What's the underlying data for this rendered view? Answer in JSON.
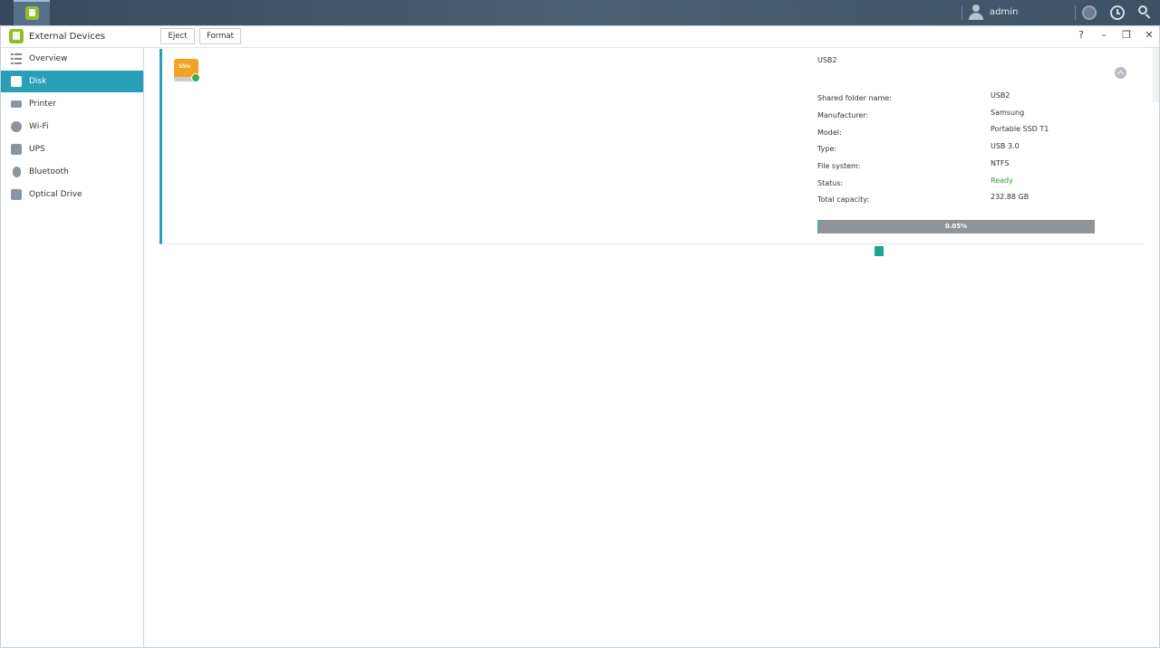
{
  "taskbar": {
    "username": "admin"
  },
  "window": {
    "title": "External Devices",
    "controls": {
      "help": "?",
      "minimize": "–",
      "restore": "❐",
      "close": "✕"
    }
  },
  "sidebar": {
    "items": [
      {
        "label": "Overview",
        "icon": "list-icon",
        "active": false
      },
      {
        "label": "Disk",
        "icon": "disk-icon",
        "active": true
      },
      {
        "label": "Printer",
        "icon": "printer-icon",
        "active": false
      },
      {
        "label": "Wi-Fi",
        "icon": "wifi-icon",
        "active": false
      },
      {
        "label": "UPS",
        "icon": "ups-icon",
        "active": false
      },
      {
        "label": "Bluetooth",
        "icon": "bluetooth-icon",
        "active": false
      },
      {
        "label": "Optical Drive",
        "icon": "optical-drive-icon",
        "active": false
      }
    ]
  },
  "toolbar": {
    "eject_label": "Eject",
    "format_label": "Format"
  },
  "device": {
    "name": "USB2",
    "fields": [
      {
        "label": "Shared folder name:",
        "value": "USB2"
      },
      {
        "label": "Manufacturer:",
        "value": "Samsung"
      },
      {
        "label": "Model:",
        "value": "Portable SSD T1"
      },
      {
        "label": "Type:",
        "value": "USB 3.0"
      },
      {
        "label": "File system:",
        "value": "NTFS"
      },
      {
        "label": "Status:",
        "value": "Ready"
      },
      {
        "label": "Total capacity:",
        "value": "232.88 GB"
      }
    ],
    "usage_text": "0.05%",
    "usage_percent": 0.05
  },
  "colors": {
    "accent": "#2a9fb8",
    "used": "#2ab29a",
    "status_ok": "#3a9a3a"
  }
}
